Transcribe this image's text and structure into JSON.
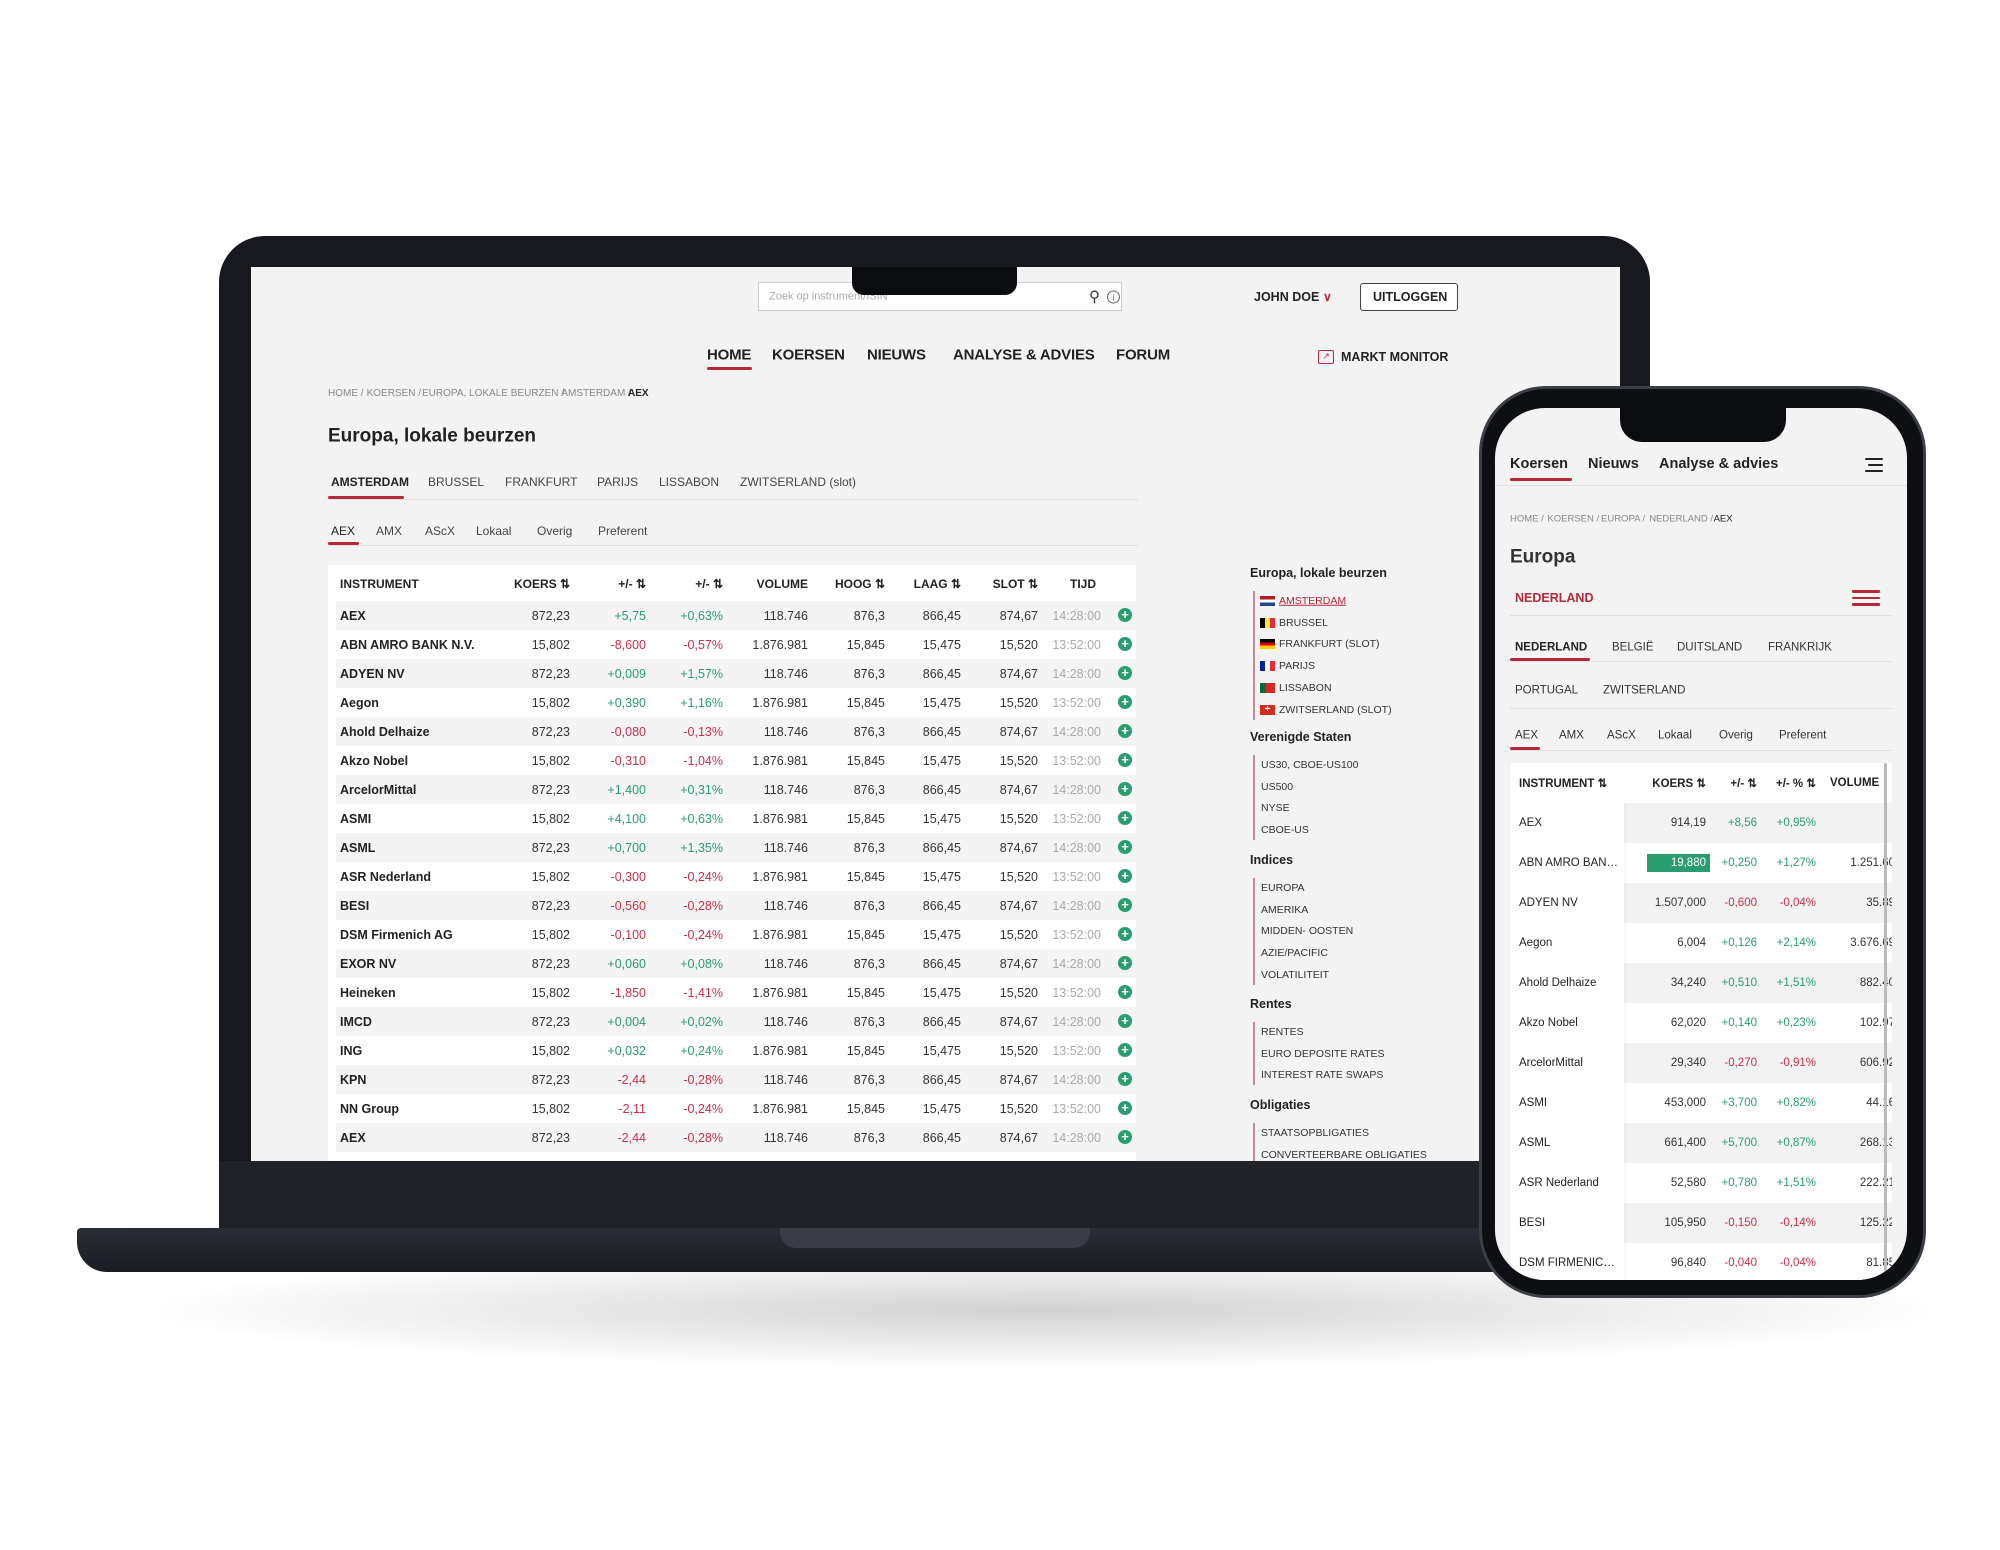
{
  "colors": {
    "accent": "#b5283a",
    "positive": "#2a9d6e",
    "negative": "#c8304a"
  },
  "desktop": {
    "search": {
      "placeholder": "Zoek op instrument/ISIN",
      "icons": [
        "search-icon",
        "info-icon"
      ]
    },
    "user": {
      "name": "JOHN DOE",
      "logout": "UITLOGGEN"
    },
    "nav": [
      {
        "label": "HOME",
        "active": true
      },
      {
        "label": "KOERSEN"
      },
      {
        "label": "NIEUWS"
      },
      {
        "label": "ANALYSE & ADVIES"
      },
      {
        "label": "FORUM"
      }
    ],
    "markt_monitor": "MARKT MONITOR",
    "breadcrumb": [
      "HOME /",
      "KOERSEN /",
      "EUROPA, LOKALE BEURZEN /",
      "AMSTERDAM /",
      "AEX"
    ],
    "title": "Europa, lokale beurzen",
    "market_tabs": [
      "AMSTERDAM",
      "BRUSSEL",
      "FRANKFURT",
      "PARIJS",
      "LISSABON",
      "ZWITSERLAND (slot)"
    ],
    "index_tabs": [
      "AEX",
      "AMX",
      "AScX",
      "Lokaal",
      "Overig",
      "Preferent"
    ],
    "table": {
      "headers": [
        "INSTRUMENT",
        "KOERS ⇅",
        "+/- ⇅",
        "+/- ⇅",
        "VOLUME",
        "HOOG ⇅",
        "LAAG ⇅",
        "SLOT ⇅",
        "TIJD"
      ],
      "rows": [
        [
          "AEX",
          "872,23",
          "+5,75",
          "+0,63%",
          "118.746",
          "876,3",
          "866,45",
          "874,67",
          "14:28:00"
        ],
        [
          "ABN AMRO BANK N.V.",
          "15,802",
          "-8,600",
          "-0,57%",
          "1.876.981",
          "15,845",
          "15,475",
          "15,520",
          "13:52:00"
        ],
        [
          "ADYEN NV",
          "872,23",
          "+0,009",
          "+1,57%",
          "118.746",
          "876,3",
          "866,45",
          "874,67",
          "14:28:00"
        ],
        [
          "Aegon",
          "15,802",
          "+0,390",
          "+1,16%",
          "1.876.981",
          "15,845",
          "15,475",
          "15,520",
          "13:52:00"
        ],
        [
          "Ahold Delhaize",
          "872,23",
          "-0,080",
          "-0,13%",
          "118.746",
          "876,3",
          "866,45",
          "874,67",
          "14:28:00"
        ],
        [
          "Akzo Nobel",
          "15,802",
          "-0,310",
          "-1,04%",
          "1.876.981",
          "15,845",
          "15,475",
          "15,520",
          "13:52:00"
        ],
        [
          "ArcelorMittal",
          "872,23",
          "+1,400",
          "+0,31%",
          "118.746",
          "876,3",
          "866,45",
          "874,67",
          "14:28:00"
        ],
        [
          "ASMI",
          "15,802",
          "+4,100",
          "+0,63%",
          "1.876.981",
          "15,845",
          "15,475",
          "15,520",
          "13:52:00"
        ],
        [
          "ASML",
          "872,23",
          "+0,700",
          "+1,35%",
          "118.746",
          "876,3",
          "866,45",
          "874,67",
          "14:28:00"
        ],
        [
          "ASR Nederland",
          "15,802",
          "-0,300",
          "-0,24%",
          "1.876.981",
          "15,845",
          "15,475",
          "15,520",
          "13:52:00"
        ],
        [
          "BESI",
          "872,23",
          "-0,560",
          "-0,28%",
          "118.746",
          "876,3",
          "866,45",
          "874,67",
          "14:28:00"
        ],
        [
          "DSM Firmenich AG",
          "15,802",
          "-0,100",
          "-0,24%",
          "1.876.981",
          "15,845",
          "15,475",
          "15,520",
          "13:52:00"
        ],
        [
          "EXOR NV",
          "872,23",
          "+0,060",
          "+0,08%",
          "118.746",
          "876,3",
          "866,45",
          "874,67",
          "14:28:00"
        ],
        [
          "Heineken",
          "15,802",
          "-1,850",
          "-1,41%",
          "1.876.981",
          "15,845",
          "15,475",
          "15,520",
          "13:52:00"
        ],
        [
          "IMCD",
          "872,23",
          "+0,004",
          "+0,02%",
          "118.746",
          "876,3",
          "866,45",
          "874,67",
          "14:28:00"
        ],
        [
          "ING",
          "15,802",
          "+0,032",
          "+0,24%",
          "1.876.981",
          "15,845",
          "15,475",
          "15,520",
          "13:52:00"
        ],
        [
          "KPN",
          "872,23",
          "-2,44",
          "-0,28%",
          "118.746",
          "876,3",
          "866,45",
          "874,67",
          "14:28:00"
        ],
        [
          "NN Group",
          "15,802",
          "-2,11",
          "-0,24%",
          "1.876.981",
          "15,845",
          "15,475",
          "15,520",
          "13:52:00"
        ],
        [
          "AEX",
          "872,23",
          "-2,44",
          "-0,28%",
          "118.746",
          "876,3",
          "866,45",
          "874,67",
          "14:28:00"
        ]
      ]
    },
    "sidebar": [
      {
        "heading": "Europa, lokale beurzen",
        "items": [
          {
            "label": "AMSTERDAM",
            "flag": "nl",
            "active": true
          },
          {
            "label": "BRUSSEL",
            "flag": "be"
          },
          {
            "label": "FRANKFURT (SLOT)",
            "flag": "de"
          },
          {
            "label": "PARIJS",
            "flag": "fr"
          },
          {
            "label": "LISSABON",
            "flag": "pt"
          },
          {
            "label": "ZWITSERLAND (SLOT)",
            "flag": "ch"
          }
        ]
      },
      {
        "heading": "Verenigde Staten",
        "items": [
          {
            "label": "US30, CBOE-US100"
          },
          {
            "label": "US500"
          },
          {
            "label": "NYSE"
          },
          {
            "label": "CBOE-US"
          }
        ]
      },
      {
        "heading": "Indices",
        "items": [
          {
            "label": "EUROPA"
          },
          {
            "label": "AMERIKA"
          },
          {
            "label": "MIDDEN- OOSTEN"
          },
          {
            "label": "AZIE/PACIFIC"
          },
          {
            "label": "VOLATILITEIT"
          }
        ]
      },
      {
        "heading": "Rentes",
        "items": [
          {
            "label": "RENTES"
          },
          {
            "label": "EURO DEPOSITE RATES"
          },
          {
            "label": "INTEREST RATE SWAPS"
          }
        ]
      },
      {
        "heading": "Obligaties",
        "items": [
          {
            "label": "STAATSOPBLIGATIES"
          },
          {
            "label": "CONVERTEERBARE OBLIGATIES"
          }
        ]
      }
    ]
  },
  "mobile": {
    "nav": [
      "Koersen",
      "Nieuws",
      "Analyse & advies"
    ],
    "breadcrumb": [
      "HOME /",
      "KOERSEN /",
      "EUROPA /",
      "NEDERLAND /",
      "AEX"
    ],
    "title": "Europa",
    "region": "NEDERLAND",
    "country_tabs": [
      "NEDERLAND",
      "BELGIË",
      "DUITSLAND",
      "FRANKRIJK",
      "PORTUGAL",
      "ZWITSERLAND"
    ],
    "index_tabs": [
      "AEX",
      "AMX",
      "AScX",
      "Lokaal",
      "Overig",
      "Preferent"
    ],
    "table": {
      "headers": [
        "INSTRUMENT ⇅",
        "KOERS ⇅",
        "+/- ⇅",
        "+/- % ⇅",
        "VOLUME"
      ],
      "rows": [
        [
          "AEX",
          "914,19",
          "+8,56",
          "+0,95%",
          ""
        ],
        [
          "ABN AMRO BAN…",
          "19,880",
          "+0,250",
          "+1,27%",
          "1.251.60"
        ],
        [
          "ADYEN NV",
          "1.507,000",
          "-0,600",
          "-0,04%",
          "35.89"
        ],
        [
          "Aegon",
          "6,004",
          "+0,126",
          "+2,14%",
          "3.676.69"
        ],
        [
          "Ahold Delhaize",
          "34,240",
          "+0,510",
          "+1,51%",
          "882.40"
        ],
        [
          "Akzo Nobel",
          "62,020",
          "+0,140",
          "+0,23%",
          "102.97"
        ],
        [
          "ArcelorMittal",
          "29,340",
          "-0,270",
          "-0,91%",
          "606.92"
        ],
        [
          "ASMI",
          "453,000",
          "+3,700",
          "+0,82%",
          "44.16"
        ],
        [
          "ASML",
          "661,400",
          "+5,700",
          "+0,87%",
          "268.13"
        ],
        [
          "ASR Nederland",
          "52,580",
          "+0,780",
          "+1,51%",
          "222.21"
        ],
        [
          "BESI",
          "105,950",
          "-0,150",
          "-0,14%",
          "125.22"
        ],
        [
          "DSM FIRMENIC…",
          "96,840",
          "-0,040",
          "-0,04%",
          "81.85"
        ]
      ],
      "highlighted_cell": {
        "row": 1,
        "column": 1,
        "color": "#2a9d6e"
      }
    }
  }
}
